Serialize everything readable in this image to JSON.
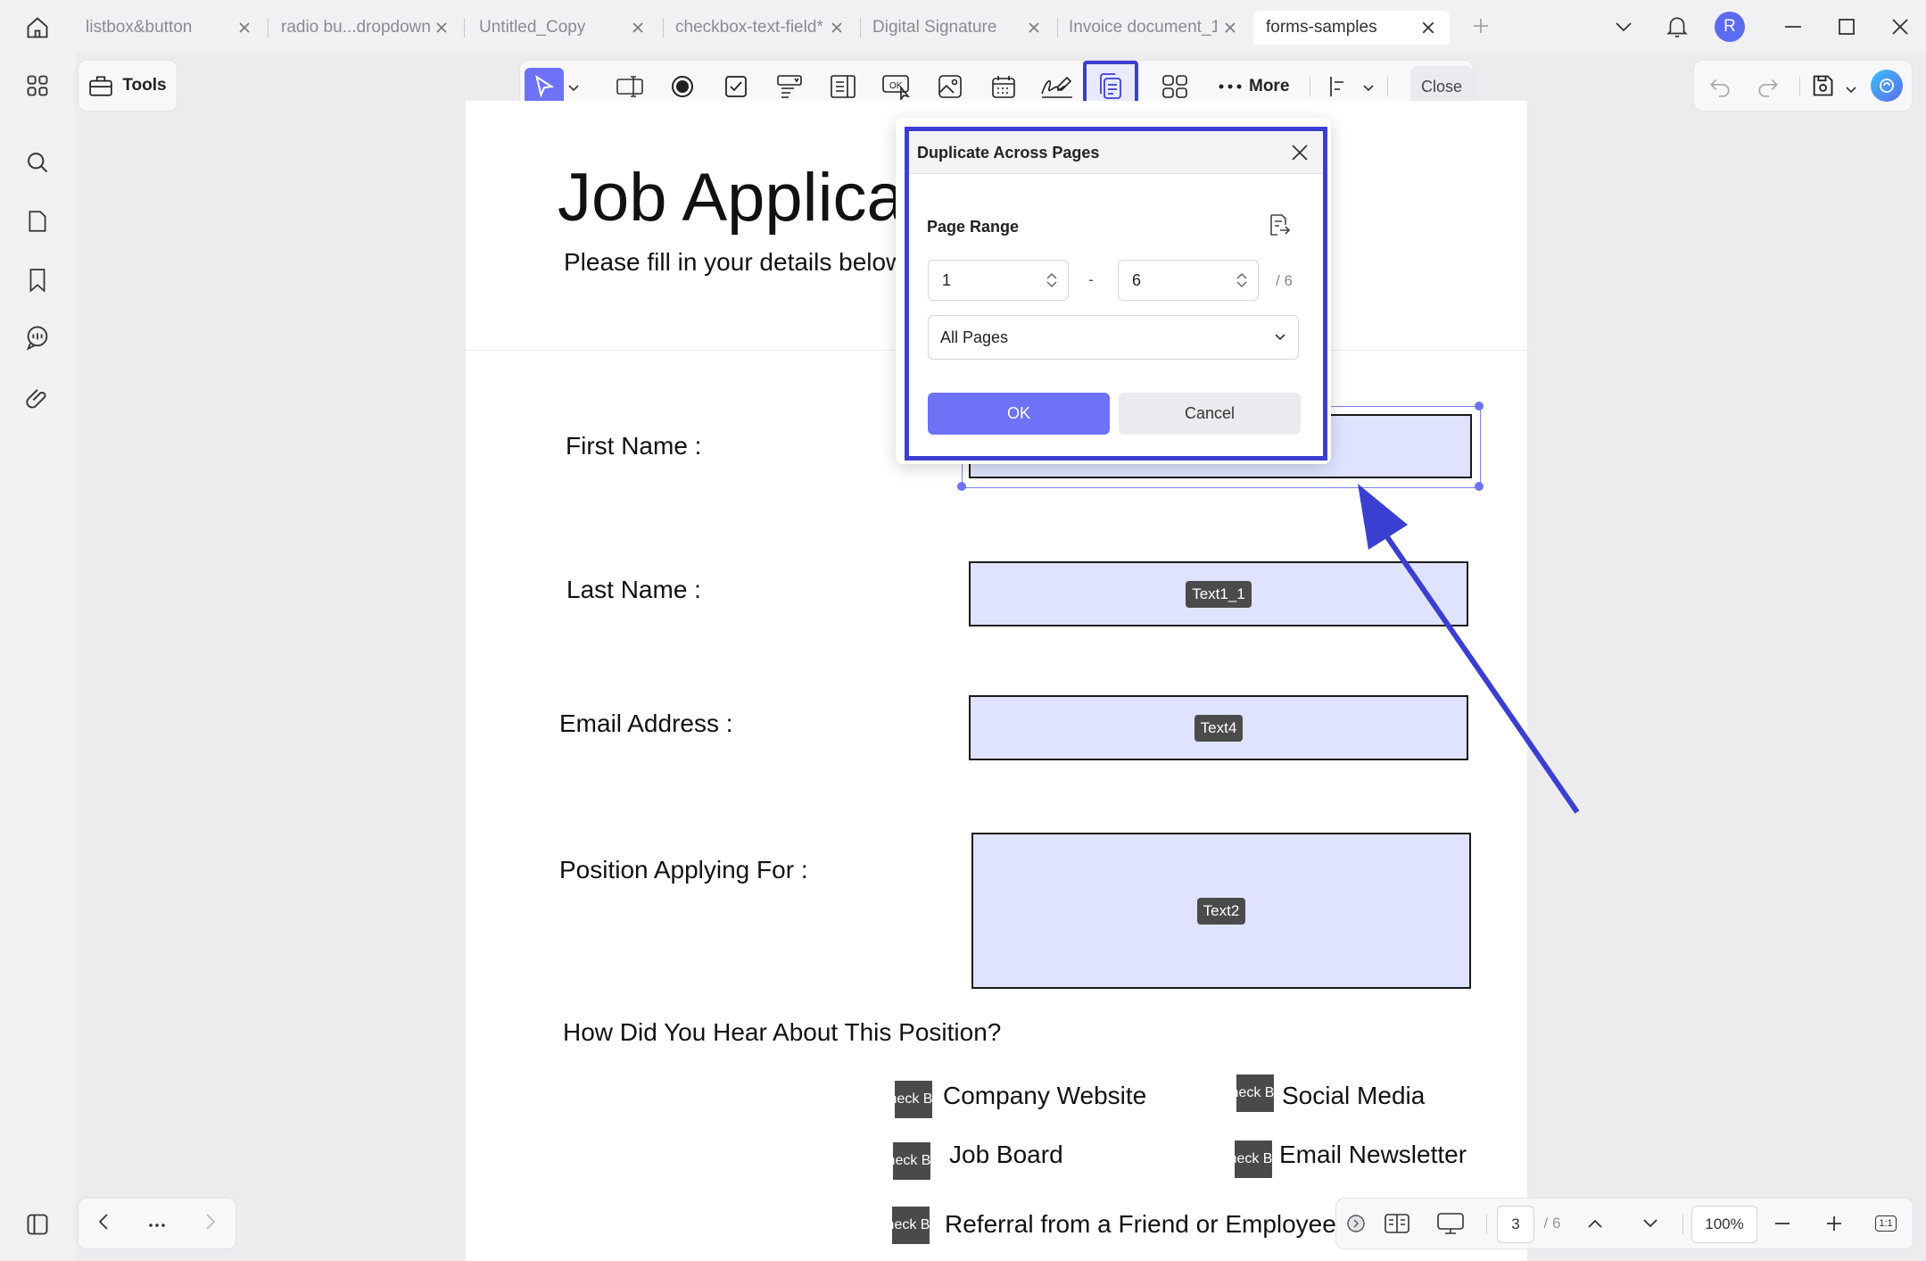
{
  "tabs": [
    {
      "label": "listbox&button"
    },
    {
      "label": "radio bu...dropdown"
    },
    {
      "label": "Untitled_Copy"
    },
    {
      "label": "checkbox-text-field*"
    },
    {
      "label": "Digital Signature"
    },
    {
      "label": "Invoice document_1*"
    },
    {
      "label": "forms-samples",
      "active": true
    }
  ],
  "user": {
    "initial": "R"
  },
  "toolbar": {
    "tools_label": "Tools",
    "more_label": "More",
    "close_label": "Close"
  },
  "document": {
    "title": "Job Application",
    "subtitle": "Please fill in your details below",
    "fields": [
      {
        "label": "First Name :"
      },
      {
        "label": "Last Name :",
        "tag": "Text1_1"
      },
      {
        "label": "Email Address :",
        "tag": "Text4"
      },
      {
        "label": "Position Applying For :",
        "tag": "Text2"
      }
    ],
    "question": "How Did You Hear About This Position?",
    "checkbox_tag": "Check Box",
    "options": [
      "Company Website",
      "Social Media",
      "Job Board",
      "Email Newsletter",
      "Referral from a Friend or Employee"
    ]
  },
  "dialog": {
    "title": "Duplicate Across Pages",
    "range_label": "Page Range",
    "from": "1",
    "to": "6",
    "dash": "-",
    "total": "/ 6",
    "subset": "All Pages",
    "ok": "OK",
    "cancel": "Cancel"
  },
  "status": {
    "current_page": "3",
    "total_pages": "/ 6",
    "zoom": "100%",
    "fit_label": "1:1"
  },
  "colors": {
    "accent": "#6d72f6",
    "highlight": "#3b3fd1",
    "field_fill": "#dfe3fe"
  }
}
